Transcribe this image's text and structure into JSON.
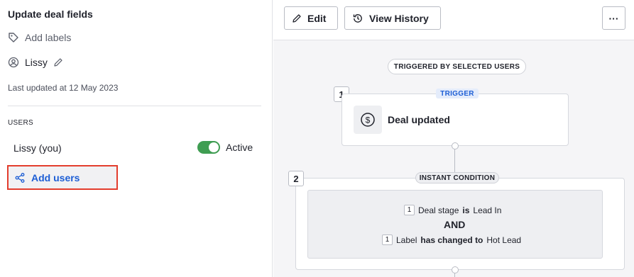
{
  "left_panel": {
    "title": "Update deal fields",
    "add_labels": "Add labels",
    "owner": "Lissy",
    "last_updated": "Last updated at 12 May 2023",
    "users_section_label": "USERS",
    "users": [
      {
        "name": "Lissy (you)",
        "status": "Active",
        "active": true
      }
    ],
    "add_users": "Add users"
  },
  "toolbar": {
    "edit_label": "Edit",
    "history_label": "View History",
    "more_label": "···"
  },
  "workflow": {
    "triggered_by": "TRIGGERED BY SELECTED USERS",
    "step1": {
      "number": "1",
      "tag": "TRIGGER",
      "title": "Deal updated",
      "icon": "dollar-circle-icon"
    },
    "step2": {
      "number": "2",
      "tag": "INSTANT CONDITION",
      "conditions": [
        {
          "index": "1",
          "field": "Deal stage",
          "operator": "is",
          "value": "Lead In"
        },
        {
          "index": "1",
          "field": "Label",
          "operator": "has changed to",
          "value": "Hot Lead"
        }
      ],
      "joiner": "AND"
    }
  },
  "colors": {
    "accent_blue": "#1d5ed5",
    "toggle_green": "#3f9d52",
    "highlight_red": "#e33d2d"
  }
}
